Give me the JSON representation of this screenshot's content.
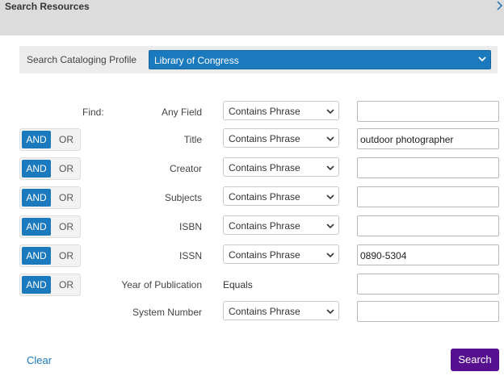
{
  "dialog": {
    "title": "Search Resources",
    "close_icon": "chevron-right-icon"
  },
  "profile": {
    "label": "Search Cataloging Profile",
    "selected": "Library of Congress",
    "accent": "#1b79bd"
  },
  "find_label": "Find:",
  "boolean": {
    "and_label": "AND",
    "or_label": "OR"
  },
  "rows": [
    {
      "field": "Any Field",
      "operator": "Contains Phrase",
      "value": ""
    },
    {
      "field": "Title",
      "operator": "Contains Phrase",
      "value": "outdoor photographer"
    },
    {
      "field": "Creator",
      "operator": "Contains Phrase",
      "value": ""
    },
    {
      "field": "Subjects",
      "operator": "Contains Phrase",
      "value": ""
    },
    {
      "field": "ISBN",
      "operator": "Contains Phrase",
      "value": ""
    },
    {
      "field": "ISSN",
      "operator": "Contains Phrase",
      "value": "0890-5304"
    },
    {
      "field": "Year of Publication",
      "operator": "Equals",
      "value": ""
    },
    {
      "field": "System Number",
      "operator": "Contains Phrase",
      "value": ""
    }
  ],
  "footer": {
    "clear_label": "Clear",
    "search_label": "Search",
    "search_color": "#56108f"
  }
}
